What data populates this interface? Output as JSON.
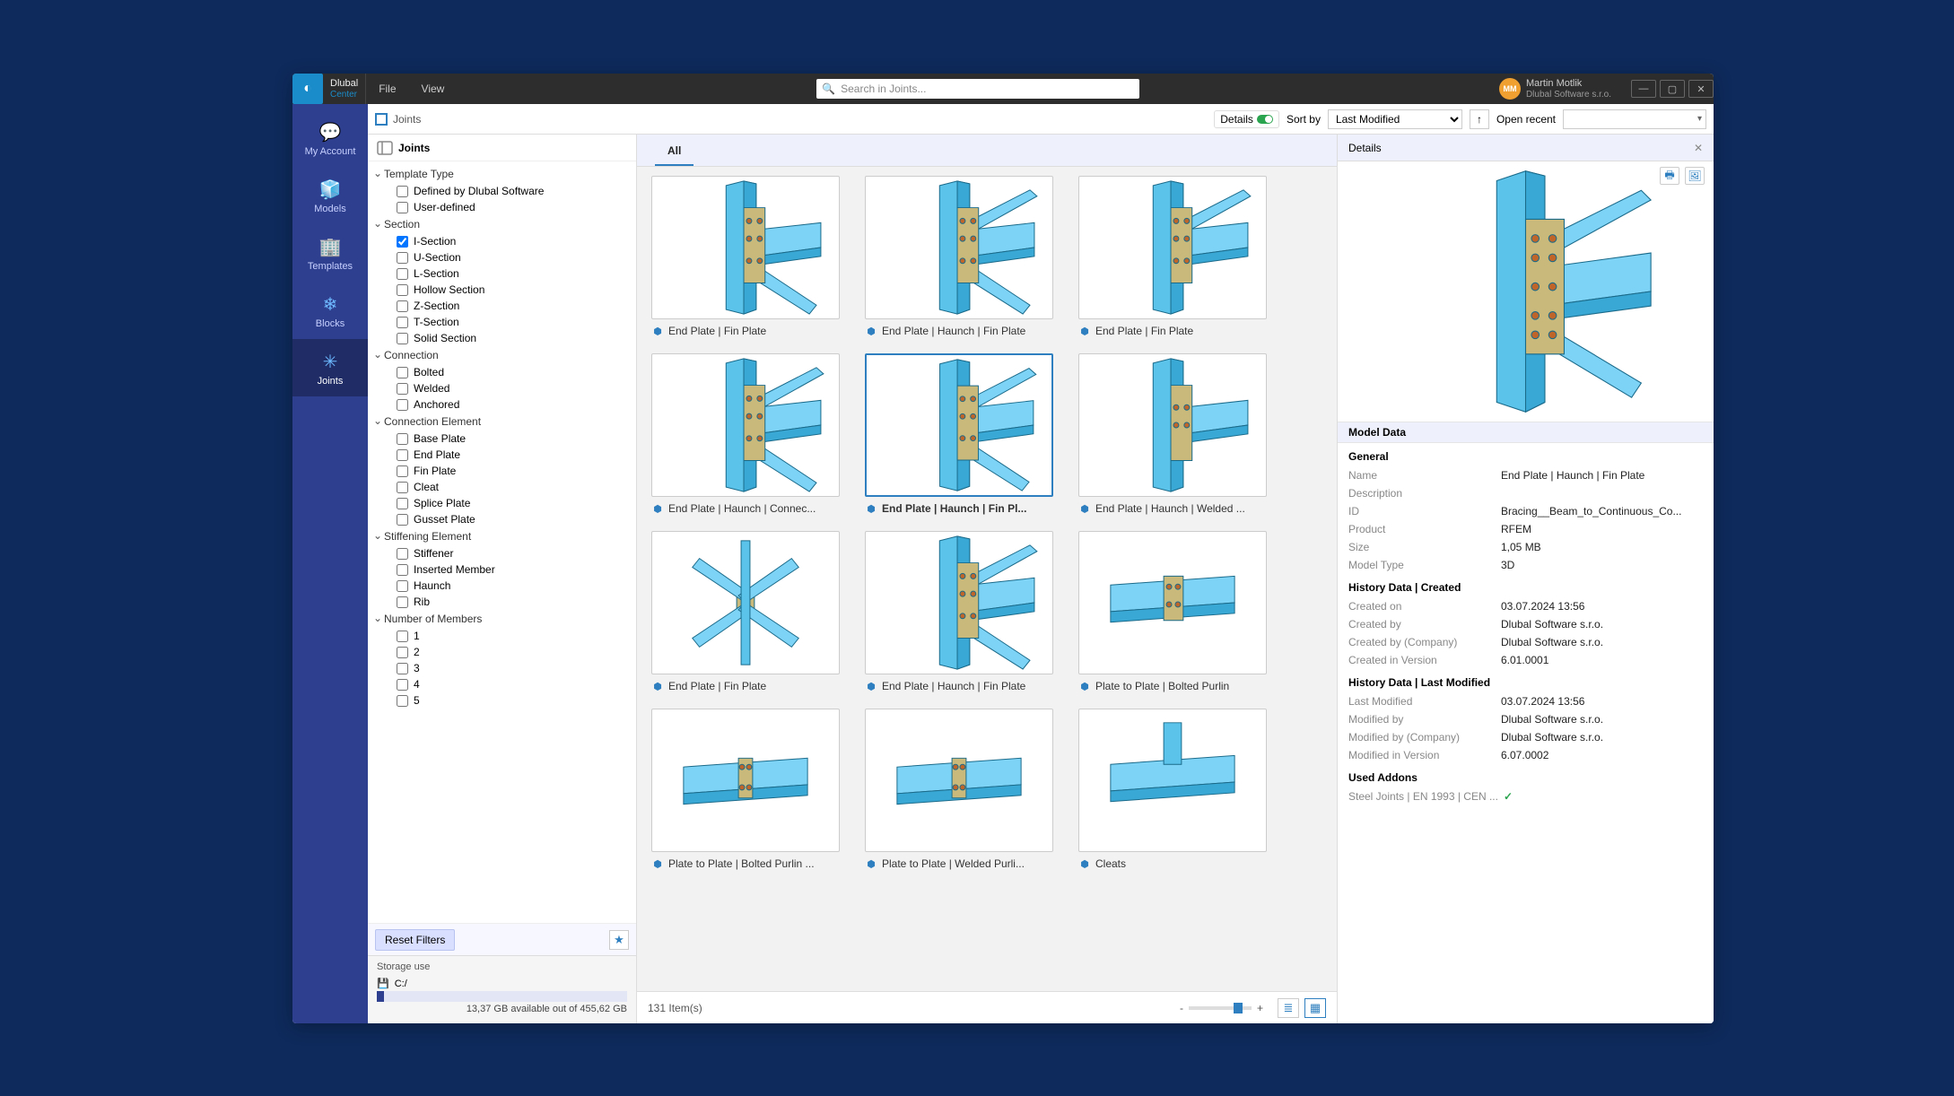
{
  "app": {
    "name_top": "Dlubal",
    "name_bottom": "Center"
  },
  "menu": [
    "File",
    "View"
  ],
  "search": {
    "placeholder": "Search in Joints..."
  },
  "user": {
    "name": "Martin Motlik",
    "company": "Dlubal Software s.r.o.",
    "initials": "MM"
  },
  "rail": [
    {
      "label": "My Account",
      "id": "rail-account"
    },
    {
      "label": "Models",
      "id": "rail-models"
    },
    {
      "label": "Templates",
      "id": "rail-templates"
    },
    {
      "label": "Blocks",
      "id": "rail-blocks"
    },
    {
      "label": "Joints",
      "id": "rail-joints"
    }
  ],
  "breadcrumb": "Joints",
  "toolbar": {
    "details": "Details",
    "sort_by": "Sort by",
    "sort_value": "Last Modified",
    "open_recent": "Open recent"
  },
  "filter": {
    "header": "Joints",
    "groups": [
      {
        "title": "Template Type",
        "items": [
          {
            "label": "Defined by Dlubal Software",
            "checked": false
          },
          {
            "label": "User-defined",
            "checked": false
          }
        ]
      },
      {
        "title": "Section",
        "items": [
          {
            "label": "I-Section",
            "checked": true
          },
          {
            "label": "U-Section",
            "checked": false
          },
          {
            "label": "L-Section",
            "checked": false
          },
          {
            "label": "Hollow Section",
            "checked": false
          },
          {
            "label": "Z-Section",
            "checked": false
          },
          {
            "label": "T-Section",
            "checked": false
          },
          {
            "label": "Solid Section",
            "checked": false
          }
        ]
      },
      {
        "title": "Connection",
        "items": [
          {
            "label": "Bolted",
            "checked": false
          },
          {
            "label": "Welded",
            "checked": false
          },
          {
            "label": "Anchored",
            "checked": false
          }
        ]
      },
      {
        "title": "Connection Element",
        "items": [
          {
            "label": "Base Plate",
            "checked": false
          },
          {
            "label": "End Plate",
            "checked": false
          },
          {
            "label": "Fin Plate",
            "checked": false
          },
          {
            "label": "Cleat",
            "checked": false
          },
          {
            "label": "Splice Plate",
            "checked": false
          },
          {
            "label": "Gusset Plate",
            "checked": false
          }
        ]
      },
      {
        "title": "Stiffening Element",
        "items": [
          {
            "label": "Stiffener",
            "checked": false
          },
          {
            "label": "Inserted Member",
            "checked": false
          },
          {
            "label": "Haunch",
            "checked": false
          },
          {
            "label": "Rib",
            "checked": false
          }
        ]
      },
      {
        "title": "Number of Members",
        "items": [
          {
            "label": "1",
            "checked": false
          },
          {
            "label": "2",
            "checked": false
          },
          {
            "label": "3",
            "checked": false
          },
          {
            "label": "4",
            "checked": false
          },
          {
            "label": "5",
            "checked": false
          }
        ]
      }
    ],
    "reset": "Reset Filters"
  },
  "storage": {
    "title": "Storage use",
    "drive": "C:/",
    "avail": "13,37 GB available out of 455,62 GB"
  },
  "tab_all": "All",
  "cards": [
    {
      "label": "End Plate | Fin Plate",
      "kind": "a"
    },
    {
      "label": "End Plate | Haunch | Fin Plate",
      "kind": "b"
    },
    {
      "label": "End Plate | Fin Plate",
      "kind": "c"
    },
    {
      "label": "End Plate | Haunch | Connec...",
      "kind": "d"
    },
    {
      "label": "End Plate | Haunch | Fin Pl...",
      "kind": "b",
      "selected": true
    },
    {
      "label": "End Plate | Haunch | Welded ...",
      "kind": "e"
    },
    {
      "label": "End Plate | Fin Plate",
      "kind": "f"
    },
    {
      "label": "End Plate | Haunch | Fin Plate",
      "kind": "g"
    },
    {
      "label": "Plate to Plate | Bolted Purlin",
      "kind": "h"
    },
    {
      "label": "Plate to Plate | Bolted Purlin ...",
      "kind": "i"
    },
    {
      "label": "Plate to Plate | Welded Purli...",
      "kind": "i"
    },
    {
      "label": "Cleats",
      "kind": "j"
    }
  ],
  "footer": {
    "count": "131 Item(s)"
  },
  "details": {
    "title": "Details",
    "model_data": "Model Data",
    "sections": {
      "general": {
        "title": "General",
        "rows": [
          {
            "k": "Name",
            "v": "End Plate | Haunch | Fin Plate"
          },
          {
            "k": "Description",
            "v": ""
          },
          {
            "k": "ID",
            "v": "Bracing__Beam_to_Continuous_Co..."
          },
          {
            "k": "Product",
            "v": "RFEM"
          },
          {
            "k": "Size",
            "v": "1,05 MB"
          },
          {
            "k": "Model Type",
            "v": "3D"
          }
        ]
      },
      "created": {
        "title": "History Data | Created",
        "rows": [
          {
            "k": "Created on",
            "v": "03.07.2024 13:56"
          },
          {
            "k": "Created by",
            "v": "Dlubal Software s.r.o."
          },
          {
            "k": "Created by (Company)",
            "v": "Dlubal Software s.r.o."
          },
          {
            "k": "Created in Version",
            "v": "6.01.0001"
          }
        ]
      },
      "modified": {
        "title": "History Data | Last Modified",
        "rows": [
          {
            "k": "Last Modified",
            "v": "03.07.2024 13:56"
          },
          {
            "k": "Modified by",
            "v": "Dlubal Software s.r.o."
          },
          {
            "k": "Modified by (Company)",
            "v": "Dlubal Software s.r.o."
          },
          {
            "k": "Modified in Version",
            "v": "6.07.0002"
          }
        ]
      },
      "addons": {
        "title": "Used Addons",
        "row": "Steel Joints | EN 1993 | CEN ..."
      }
    }
  }
}
